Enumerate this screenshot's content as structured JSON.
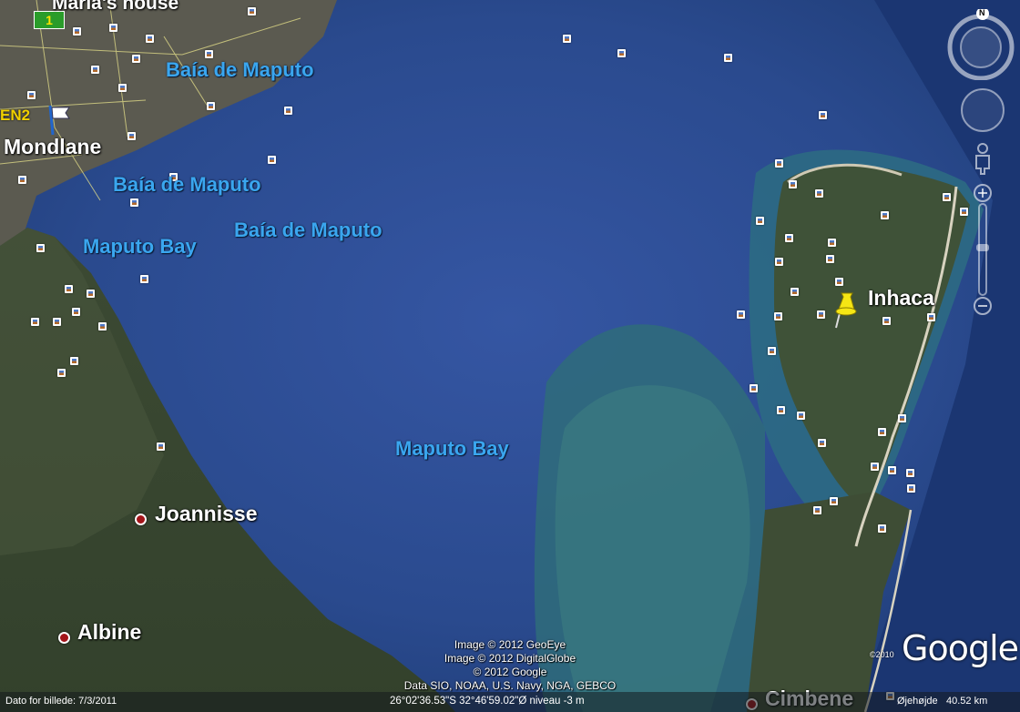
{
  "labels": {
    "marias_house": "Maria's house",
    "mondlane": "Mondlane",
    "en2": "EN2",
    "route_badge": "1",
    "baia1": "Baía de Maputo",
    "baia2": "Baía de Maputo",
    "baia3": "Baía de Maputo",
    "maputo_bay_left": "Maputo Bay",
    "maputo_bay_center": "Maputo Bay",
    "inhaca": "Inhaca",
    "joannisse": "Joannisse",
    "albine": "Albine",
    "cimbene": "Cimbene"
  },
  "attribution": {
    "line1": "Image © 2012 GeoEye",
    "line2": "Image © 2012 DigitalGlobe",
    "line3": "© 2012 Google",
    "line4": "Data SIO, NOAA, U.S. Navy, NGA, GEBCO"
  },
  "status": {
    "image_date": "Dato for billede: 7/3/2011",
    "coordinates": "26°02'36.53\"S  32°46'59.02\"Ø niveau  -3 m",
    "eye_alt_label": "Øjehøjde",
    "eye_alt_value": "40.52 km"
  },
  "brand": {
    "google": "Google",
    "copyright_year": "©2010"
  },
  "controls": {
    "north_letter": "N"
  },
  "icons": {
    "pushpin": "yellow-pushpin-icon",
    "photo": "photo-marker-icon",
    "flag": "flag-icon",
    "place": "place-dot-icon"
  },
  "colors": {
    "water_label": "#3aa6ef",
    "pin": "#f5e614",
    "place_dot": "#a3151a"
  }
}
